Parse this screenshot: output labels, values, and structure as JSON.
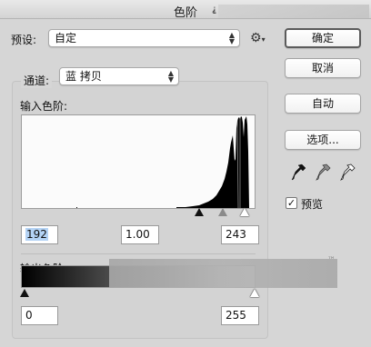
{
  "window": {
    "title": "色阶",
    "title_mark": "⸘"
  },
  "preset": {
    "label": "预设:",
    "value": "自定"
  },
  "channel": {
    "label": "通道:",
    "value": "蓝 拷贝"
  },
  "input": {
    "label": "输入色阶:",
    "black": "192",
    "gamma": "1.00",
    "white": "243"
  },
  "output": {
    "label": "输出色阶:",
    "black": "0",
    "white": "255"
  },
  "buttons": {
    "ok": "确定",
    "cancel": "取消",
    "auto": "自动",
    "options": "选项..."
  },
  "preview": {
    "label": "预览",
    "checked": true
  },
  "watermark": {
    "tm": "™"
  },
  "icons": {
    "gear": "gear-icon",
    "eyedropper_black": "black-eyedropper-icon",
    "eyedropper_gray": "gray-eyedropper-icon",
    "eyedropper_white": "white-eyedropper-icon"
  },
  "colors": {
    "selection": "#b4d3f5",
    "histogram": "#000000"
  }
}
